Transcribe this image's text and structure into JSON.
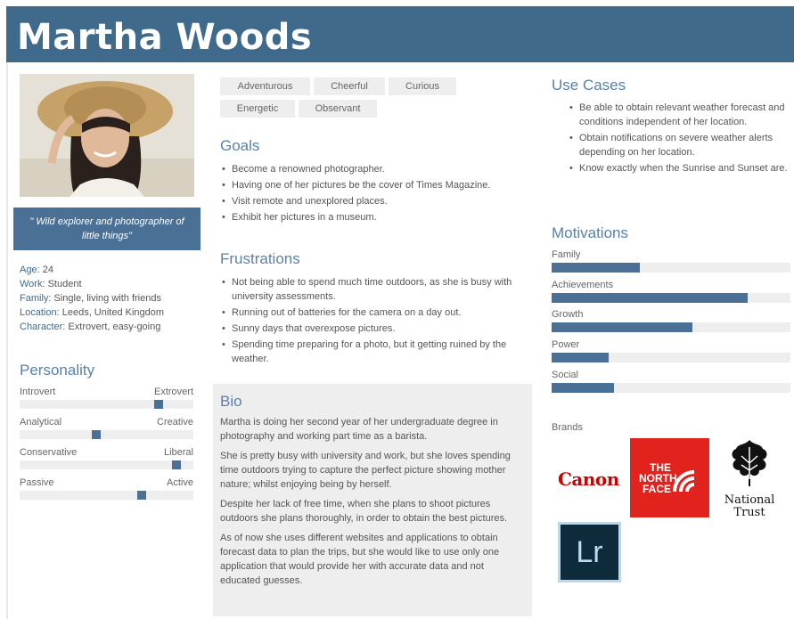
{
  "persona": {
    "name": "Martha Woods"
  },
  "quote": "\" Wild explorer and photographer of little things\"",
  "facts": [
    {
      "key": "Age:",
      "value": "24"
    },
    {
      "key": "Work:",
      "value": "Student"
    },
    {
      "key": "Family:",
      "value": "Single, living with friends"
    },
    {
      "key": "Location:",
      "value": "Leeds, United Kingdom"
    },
    {
      "key": "Character:",
      "value": "Extrovert, easy-going"
    }
  ],
  "personality": {
    "title": "Personality",
    "scales": [
      {
        "left": "Introvert",
        "right": "Extrovert",
        "value": 0.8
      },
      {
        "left": "Analytical",
        "right": "Creative",
        "value": 0.44
      },
      {
        "left": "Conservative",
        "right": "Liberal",
        "value": 0.9
      },
      {
        "left": "Passive",
        "right": "Active",
        "value": 0.7
      }
    ]
  },
  "tags": [
    "Adventurous",
    "Cheerful",
    "Curious",
    "Energetic",
    "Observant"
  ],
  "goals": {
    "title": "Goals",
    "items": [
      "Become a renowned photographer.",
      "Having one of her pictures be the cover of Times Magazine.",
      "Visit remote and unexplored places.",
      "Exhibit her pictures in a museum."
    ]
  },
  "frustrations": {
    "title": "Frustrations",
    "items": [
      "Not being able to spend much time outdoors, as she is busy with university assessments.",
      "Running out of batteries for the camera on a day out.",
      "Sunny days that overexpose pictures.",
      "Spending time preparing for a photo, but it getting ruined by the weather."
    ]
  },
  "bio": {
    "title": "Bio",
    "paragraphs": [
      "Martha is doing her second year of her undergraduate degree in photography and working part time as a barista.",
      "She is pretty busy with university and work, but she loves spending time outdoors trying to capture the perfect picture showing mother nature; whilst enjoying being by herself.",
      "Despite her lack of free time, when she plans to shoot pictures outdoors she plans thoroughly, in order to obtain the best pictures.",
      "As of now she uses different websites and applications to obtain forecast data to plan the trips, but she would like to use only one application that would provide her with accurate data and not educated guesses."
    ]
  },
  "use_cases": {
    "title": "Use Cases",
    "items": [
      "Be able to obtain relevant weather forecast and conditions independent of her location.",
      "Obtain notifications on severe weather alerts depending on her location.",
      "Know exactly when the Sunrise and Sunset are."
    ]
  },
  "motivations": {
    "title": "Motivations",
    "items": [
      {
        "label": "Family",
        "value": 0.37
      },
      {
        "label": "Achievements",
        "value": 0.82
      },
      {
        "label": "Growth",
        "value": 0.59
      },
      {
        "label": "Power",
        "value": 0.24
      },
      {
        "label": "Social",
        "value": 0.26
      }
    ]
  },
  "brands": {
    "label": "Brands",
    "canon": "Canon",
    "tnf_lines": [
      "THE",
      "NORTH",
      "FACE"
    ],
    "nt_lines": [
      "National",
      "Trust"
    ],
    "lr": "Lr"
  },
  "colors": {
    "accent": "#3f6a8c",
    "bar": "#4b7096",
    "track": "#eeeeee",
    "tnf_red": "#e1221d",
    "canon_red": "#cc0000"
  }
}
